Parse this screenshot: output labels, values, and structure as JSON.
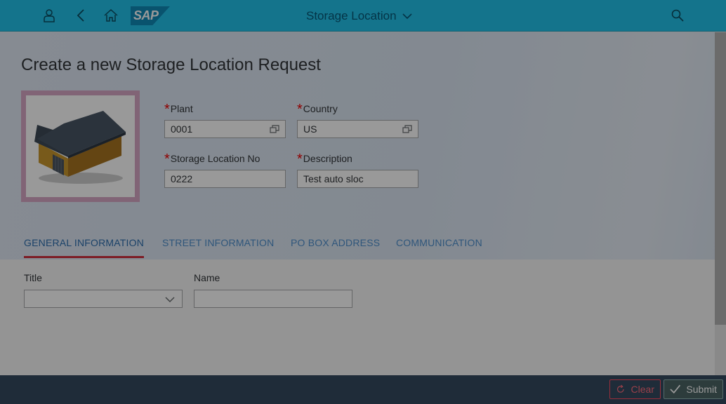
{
  "shell": {
    "title": "Storage Location",
    "logo_text": "SAP",
    "icons": [
      "user-icon",
      "back-icon",
      "home-icon",
      "chevron-down-icon",
      "search-icon"
    ]
  },
  "form": {
    "title": "Create a new Storage Location Request",
    "required_marker": "*",
    "plant": {
      "label": "Plant",
      "value": "0001"
    },
    "country": {
      "label": "Country",
      "value": "US"
    },
    "storage_location": {
      "label": "Storage Location No",
      "value": "0222"
    },
    "description": {
      "label": "Description",
      "value": "Test auto sloc"
    }
  },
  "tabs": [
    {
      "label": "GENERAL INFORMATION",
      "selected": true
    },
    {
      "label": "STREET INFORMATION",
      "selected": false
    },
    {
      "label": "PO BOX ADDRESS",
      "selected": false
    },
    {
      "label": "COMMUNICATION",
      "selected": false
    }
  ],
  "general": {
    "title_field": {
      "label": "Title",
      "value": ""
    },
    "name_field": {
      "label": "Name",
      "value": ""
    }
  },
  "footer": {
    "clear_label": "Clear",
    "submit_label": "Submit"
  },
  "colors": {
    "shell": "#22c2e9",
    "footer": "#354a5f",
    "required": "#ee0000",
    "tab_selected_underline": "#d1303f",
    "clear_accent": "#ff4d61"
  }
}
